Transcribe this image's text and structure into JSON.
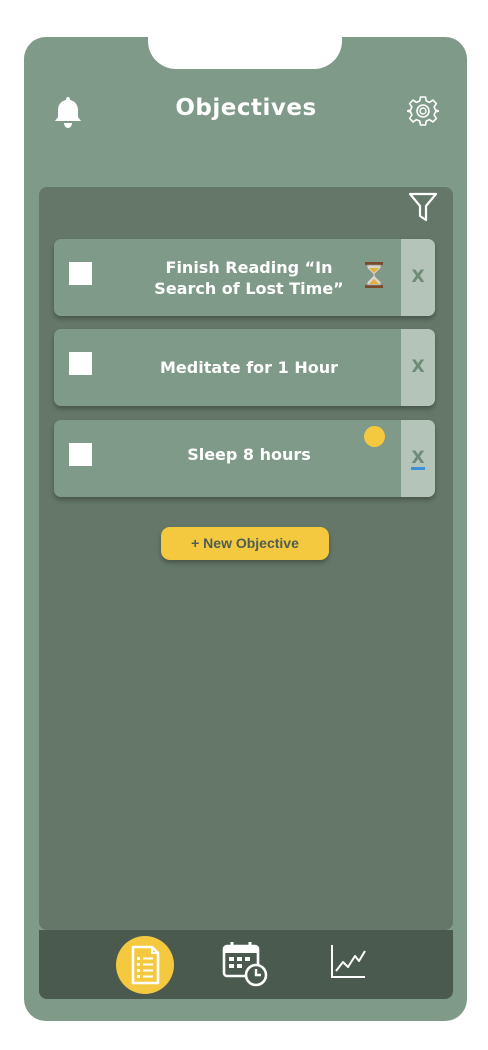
{
  "header": {
    "title": "Objectives",
    "left_icon": "bell-icon",
    "right_icon": "gear-icon"
  },
  "panel": {
    "filter_icon": "filter-icon"
  },
  "objectives": [
    {
      "label_line1": "Finish Reading “In",
      "label_line2": "Search of Lost Time”",
      "status_icon": "hourglass-icon",
      "delete_label": "X"
    },
    {
      "label": "Meditate for 1 Hour",
      "delete_label": "X"
    },
    {
      "label": "Sleep 8 hours",
      "status_icon": "yellow-dot",
      "delete_label": "X"
    }
  ],
  "new_objective_button": "+ New Objective",
  "nav": {
    "items": [
      {
        "icon": "document-list-icon",
        "active": true
      },
      {
        "icon": "calendar-clock-icon",
        "active": false
      },
      {
        "icon": "line-chart-icon",
        "active": false
      }
    ]
  },
  "colors": {
    "background": "#7f9a88",
    "panel": "#647768",
    "navbar": "#4a5a4f",
    "accent": "#f4c93f",
    "delete_strip": "#b4c4b9"
  }
}
